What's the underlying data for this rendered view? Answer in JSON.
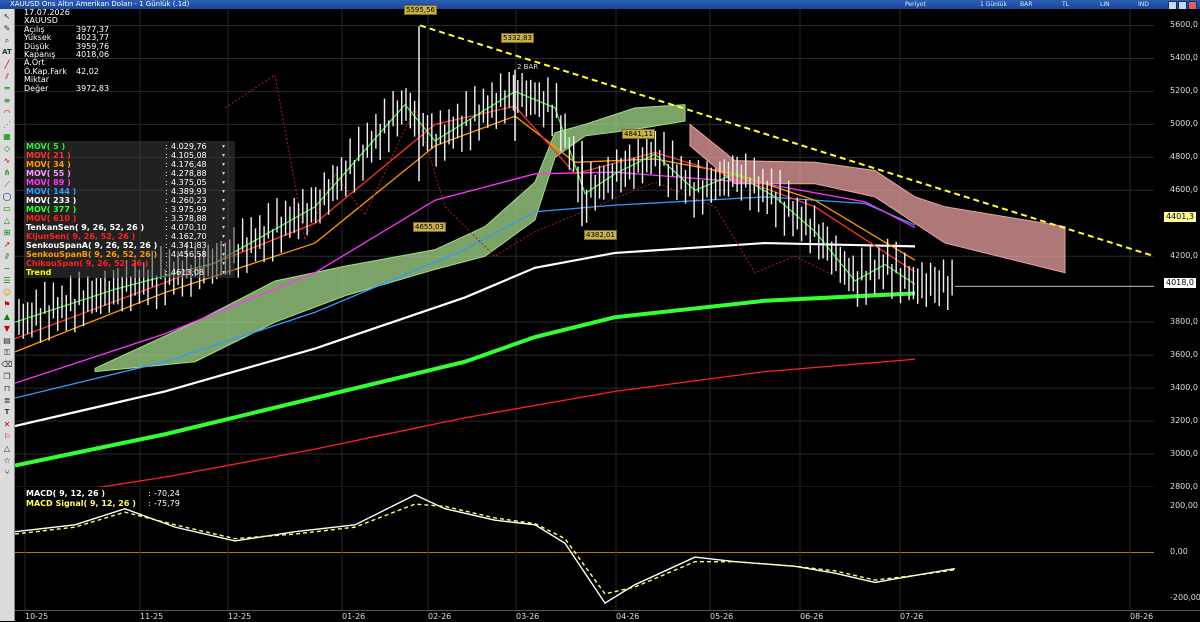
{
  "window": {
    "title": "XAUUSD Ons Altın Amerikan Doları - 1 Günlük (.1d)",
    "toolbar_right": [
      "Periyot",
      "1 Günlük",
      "BAR",
      "TL",
      "LIN",
      "IND"
    ]
  },
  "info": {
    "date": "17.07.2026",
    "symbol": "XAUUSD",
    "rows": [
      {
        "k": "Açılış",
        "v": "3977,37"
      },
      {
        "k": "Yüksek",
        "v": "4023,77"
      },
      {
        "k": "Düşük",
        "v": "3959,76"
      },
      {
        "k": "Kapanış",
        "v": "4018,06"
      },
      {
        "k": "A.Ort",
        "v": ""
      },
      {
        "k": "Ö.Kap.Fark",
        "v": "42,02"
      },
      {
        "k": "Miktar",
        "v": ""
      },
      {
        "k": "Değer",
        "v": "3972,83"
      }
    ]
  },
  "indicators": [
    {
      "label": "MOV( 5 )",
      "value": "4.029,76",
      "color": "#39e639"
    },
    {
      "label": "MOV( 21 )",
      "value": "4.105,08",
      "color": "#ff3030"
    },
    {
      "label": "MOV( 34 )",
      "value": "4.176,48",
      "color": "#ff9900"
    },
    {
      "label": "MOV( 55 )",
      "value": "4.278,88",
      "color": "#ff99ff"
    },
    {
      "label": "MOV( 89 )",
      "value": "4.375,05",
      "color": "#ff33ff"
    },
    {
      "label": "MOV( 144 )",
      "value": "4.389,93",
      "color": "#3399ff"
    },
    {
      "label": "MOV( 233 )",
      "value": "4.260,23",
      "color": "#ffffff"
    },
    {
      "label": "MOV( 377 )",
      "value": "3.975,99",
      "color": "#33ff33"
    },
    {
      "label": "MOV( 610 )",
      "value": "3.578,88",
      "color": "#ff2020"
    },
    {
      "label": "TenkanSen( 9, 26, 52, 26 )",
      "value": "4.070,10",
      "color": "#ffffff"
    },
    {
      "label": "KijunSen( 9, 26, 52, 26 )",
      "value": "4.162,70",
      "color": "#ff2020"
    },
    {
      "label": "SenkouSpanA( 9, 26, 52, 26 )",
      "value": "4.341,83",
      "color": "#ffffff"
    },
    {
      "label": "SenkouSpanB( 9, 26, 52, 26 )",
      "value": "4.456,58",
      "color": "#ff9900"
    },
    {
      "label": "ChikouSpan( 9, 26, 52, 26 )",
      "value": "",
      "color": "#ff2020"
    },
    {
      "label": "Trend",
      "value": "4613,08",
      "color": "#ffff00"
    }
  ],
  "macd": [
    {
      "label": "MACD( 9, 12, 26 )",
      "value": "-70,24",
      "color": "#ffffff"
    },
    {
      "label": "MACD Signal( 9, 12, 26 )",
      "value": "-75,79",
      "color": "#ffff66"
    }
  ],
  "annotations": {
    "high": "5595,56",
    "peak2": "5332,83",
    "bar_note": "2 BAR",
    "mid": "4841,11",
    "low1": "4655,03",
    "low2": "4382,01"
  },
  "axis_labels": {
    "trend_price": "4401,3",
    "last_price": "4018,0"
  },
  "colors": {
    "cloud_bull": "#a6d98a",
    "cloud_bear": "#e8a0a0",
    "trend_line": "#ffff33"
  },
  "chart_data": {
    "type": "line",
    "ylim": [
      2800,
      5700
    ],
    "y_ticks": [
      "5600,0",
      "5400,0",
      "5200,0",
      "5000,0",
      "4800,0",
      "4600,0",
      "4200,0",
      "3800,0",
      "3600,0",
      "3400,0",
      "3200,0",
      "3000,0",
      "2800,0"
    ],
    "x_ticks": [
      "10-25",
      "11-25",
      "12-25",
      "01-26",
      "02-26",
      "03-26",
      "04-26",
      "05-26",
      "06-26",
      "07-26",
      "08-26"
    ],
    "macd_ticks": [
      "200,00",
      "0,00",
      "-200,00"
    ],
    "macd_ylim": [
      -250,
      280
    ],
    "series": [
      {
        "name": "MOV( 610 )",
        "color": "#ff2020",
        "pts": [
          [
            0,
            2720
          ],
          [
            150,
            2860
          ],
          [
            300,
            3030
          ],
          [
            450,
            3220
          ],
          [
            600,
            3380
          ],
          [
            750,
            3500
          ],
          [
            900,
            3575
          ]
        ]
      },
      {
        "name": "MOV( 377 )",
        "color": "#33ff33",
        "pts": [
          [
            0,
            2930
          ],
          [
            150,
            3120
          ],
          [
            300,
            3340
          ],
          [
            450,
            3560
          ],
          [
            520,
            3710
          ],
          [
            600,
            3830
          ],
          [
            750,
            3930
          ],
          [
            900,
            3975
          ]
        ]
      },
      {
        "name": "MOV( 233 )",
        "color": "#ffffff",
        "pts": [
          [
            0,
            3170
          ],
          [
            150,
            3380
          ],
          [
            300,
            3640
          ],
          [
            450,
            3950
          ],
          [
            520,
            4130
          ],
          [
            600,
            4220
          ],
          [
            750,
            4280
          ],
          [
            900,
            4260
          ]
        ]
      },
      {
        "name": "MOV( 144 )",
        "color": "#3399ff",
        "pts": [
          [
            0,
            3340
          ],
          [
            150,
            3560
          ],
          [
            300,
            3860
          ],
          [
            450,
            4240
          ],
          [
            520,
            4470
          ],
          [
            600,
            4510
          ],
          [
            750,
            4560
          ],
          [
            850,
            4520
          ],
          [
            900,
            4390
          ]
        ]
      },
      {
        "name": "MOV( 89 )",
        "color": "#ff33ff",
        "pts": [
          [
            0,
            3430
          ],
          [
            150,
            3730
          ],
          [
            300,
            4100
          ],
          [
            420,
            4540
          ],
          [
            520,
            4700
          ],
          [
            600,
            4710
          ],
          [
            750,
            4640
          ],
          [
            850,
            4530
          ],
          [
            900,
            4375
          ]
        ]
      },
      {
        "name": "MOV( 34 )",
        "color": "#ff9900",
        "pts": [
          [
            0,
            3620
          ],
          [
            150,
            3980
          ],
          [
            300,
            4280
          ],
          [
            420,
            4870
          ],
          [
            500,
            5050
          ],
          [
            560,
            4770
          ],
          [
            640,
            4790
          ],
          [
            720,
            4700
          ],
          [
            800,
            4540
          ],
          [
            900,
            4176
          ]
        ]
      },
      {
        "name": "MOV( 21 )",
        "color": "#ff3030",
        "pts": [
          [
            0,
            3700
          ],
          [
            150,
            4040
          ],
          [
            300,
            4400
          ],
          [
            420,
            5000
          ],
          [
            500,
            5110
          ],
          [
            560,
            4700
          ],
          [
            640,
            4830
          ],
          [
            720,
            4680
          ],
          [
            800,
            4500
          ],
          [
            900,
            4105
          ]
        ]
      },
      {
        "name": "MOV( 5 )",
        "color": "#39e639",
        "pts": [
          [
            0,
            3800
          ],
          [
            100,
            4000
          ],
          [
            200,
            4160
          ],
          [
            300,
            4500
          ],
          [
            390,
            5120
          ],
          [
            420,
            4900
          ],
          [
            500,
            5200
          ],
          [
            540,
            5100
          ],
          [
            570,
            4580
          ],
          [
            600,
            4700
          ],
          [
            640,
            4820
          ],
          [
            680,
            4600
          ],
          [
            720,
            4700
          ],
          [
            760,
            4560
          ],
          [
            800,
            4350
          ],
          [
            840,
            4050
          ],
          [
            870,
            4150
          ],
          [
            900,
            4030
          ]
        ]
      }
    ],
    "trend_line": [
      [
        405,
        5600
      ],
      [
        1150,
        4180
      ]
    ],
    "macd_series": [
      {
        "name": "MACD( 9, 12, 26 )",
        "color": "#ffffff",
        "pts": [
          [
            0,
            90
          ],
          [
            60,
            120
          ],
          [
            110,
            190
          ],
          [
            160,
            110
          ],
          [
            220,
            50
          ],
          [
            280,
            90
          ],
          [
            340,
            120
          ],
          [
            400,
            250
          ],
          [
            430,
            190
          ],
          [
            480,
            140
          ],
          [
            520,
            120
          ],
          [
            550,
            40
          ],
          [
            590,
            -220
          ],
          [
            620,
            -140
          ],
          [
            680,
            -20
          ],
          [
            720,
            -40
          ],
          [
            780,
            -60
          ],
          [
            820,
            -90
          ],
          [
            860,
            -130
          ],
          [
            900,
            -100
          ],
          [
            940,
            -70
          ]
        ]
      },
      {
        "name": "MACD Signal( 9, 12, 26 )",
        "color": "#ffff66",
        "pts": [
          [
            0,
            80
          ],
          [
            60,
            110
          ],
          [
            110,
            175
          ],
          [
            160,
            120
          ],
          [
            220,
            60
          ],
          [
            280,
            80
          ],
          [
            340,
            110
          ],
          [
            400,
            210
          ],
          [
            430,
            200
          ],
          [
            480,
            150
          ],
          [
            520,
            125
          ],
          [
            550,
            60
          ],
          [
            590,
            -180
          ],
          [
            620,
            -150
          ],
          [
            680,
            -40
          ],
          [
            720,
            -40
          ],
          [
            780,
            -60
          ],
          [
            820,
            -80
          ],
          [
            860,
            -120
          ],
          [
            900,
            -100
          ],
          [
            940,
            -75
          ]
        ]
      }
    ]
  }
}
